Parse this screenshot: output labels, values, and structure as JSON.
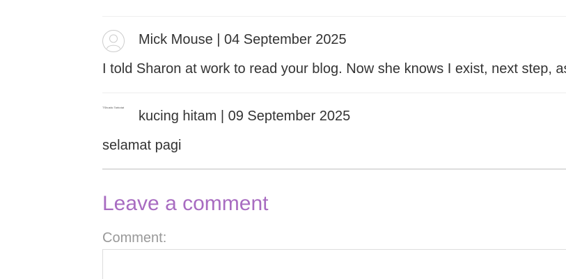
{
  "comments": [
    {
      "author": "Mick Mouse",
      "date": "04 September 2025",
      "meta": "Mick Mouse | 04 September 2025",
      "body": "I told Sharon at work to read your blog. Now she knows I exist, next step, as",
      "avatar": "default-user-avatar-icon"
    },
    {
      "author": "kucing hitam",
      "date": "09 September 2025",
      "meta": "kucing hitam | 09 September 2025",
      "body": "selamat pagi",
      "avatar_alt": "TShustic Tarbotat"
    }
  ],
  "leave_comment": {
    "heading": "Leave a comment",
    "comment_label": "Comment:",
    "comment_value": ""
  },
  "colors": {
    "heading_accent": "#a86cc1",
    "text": "#333333",
    "label": "#999999",
    "divider": "#eeeeee"
  }
}
